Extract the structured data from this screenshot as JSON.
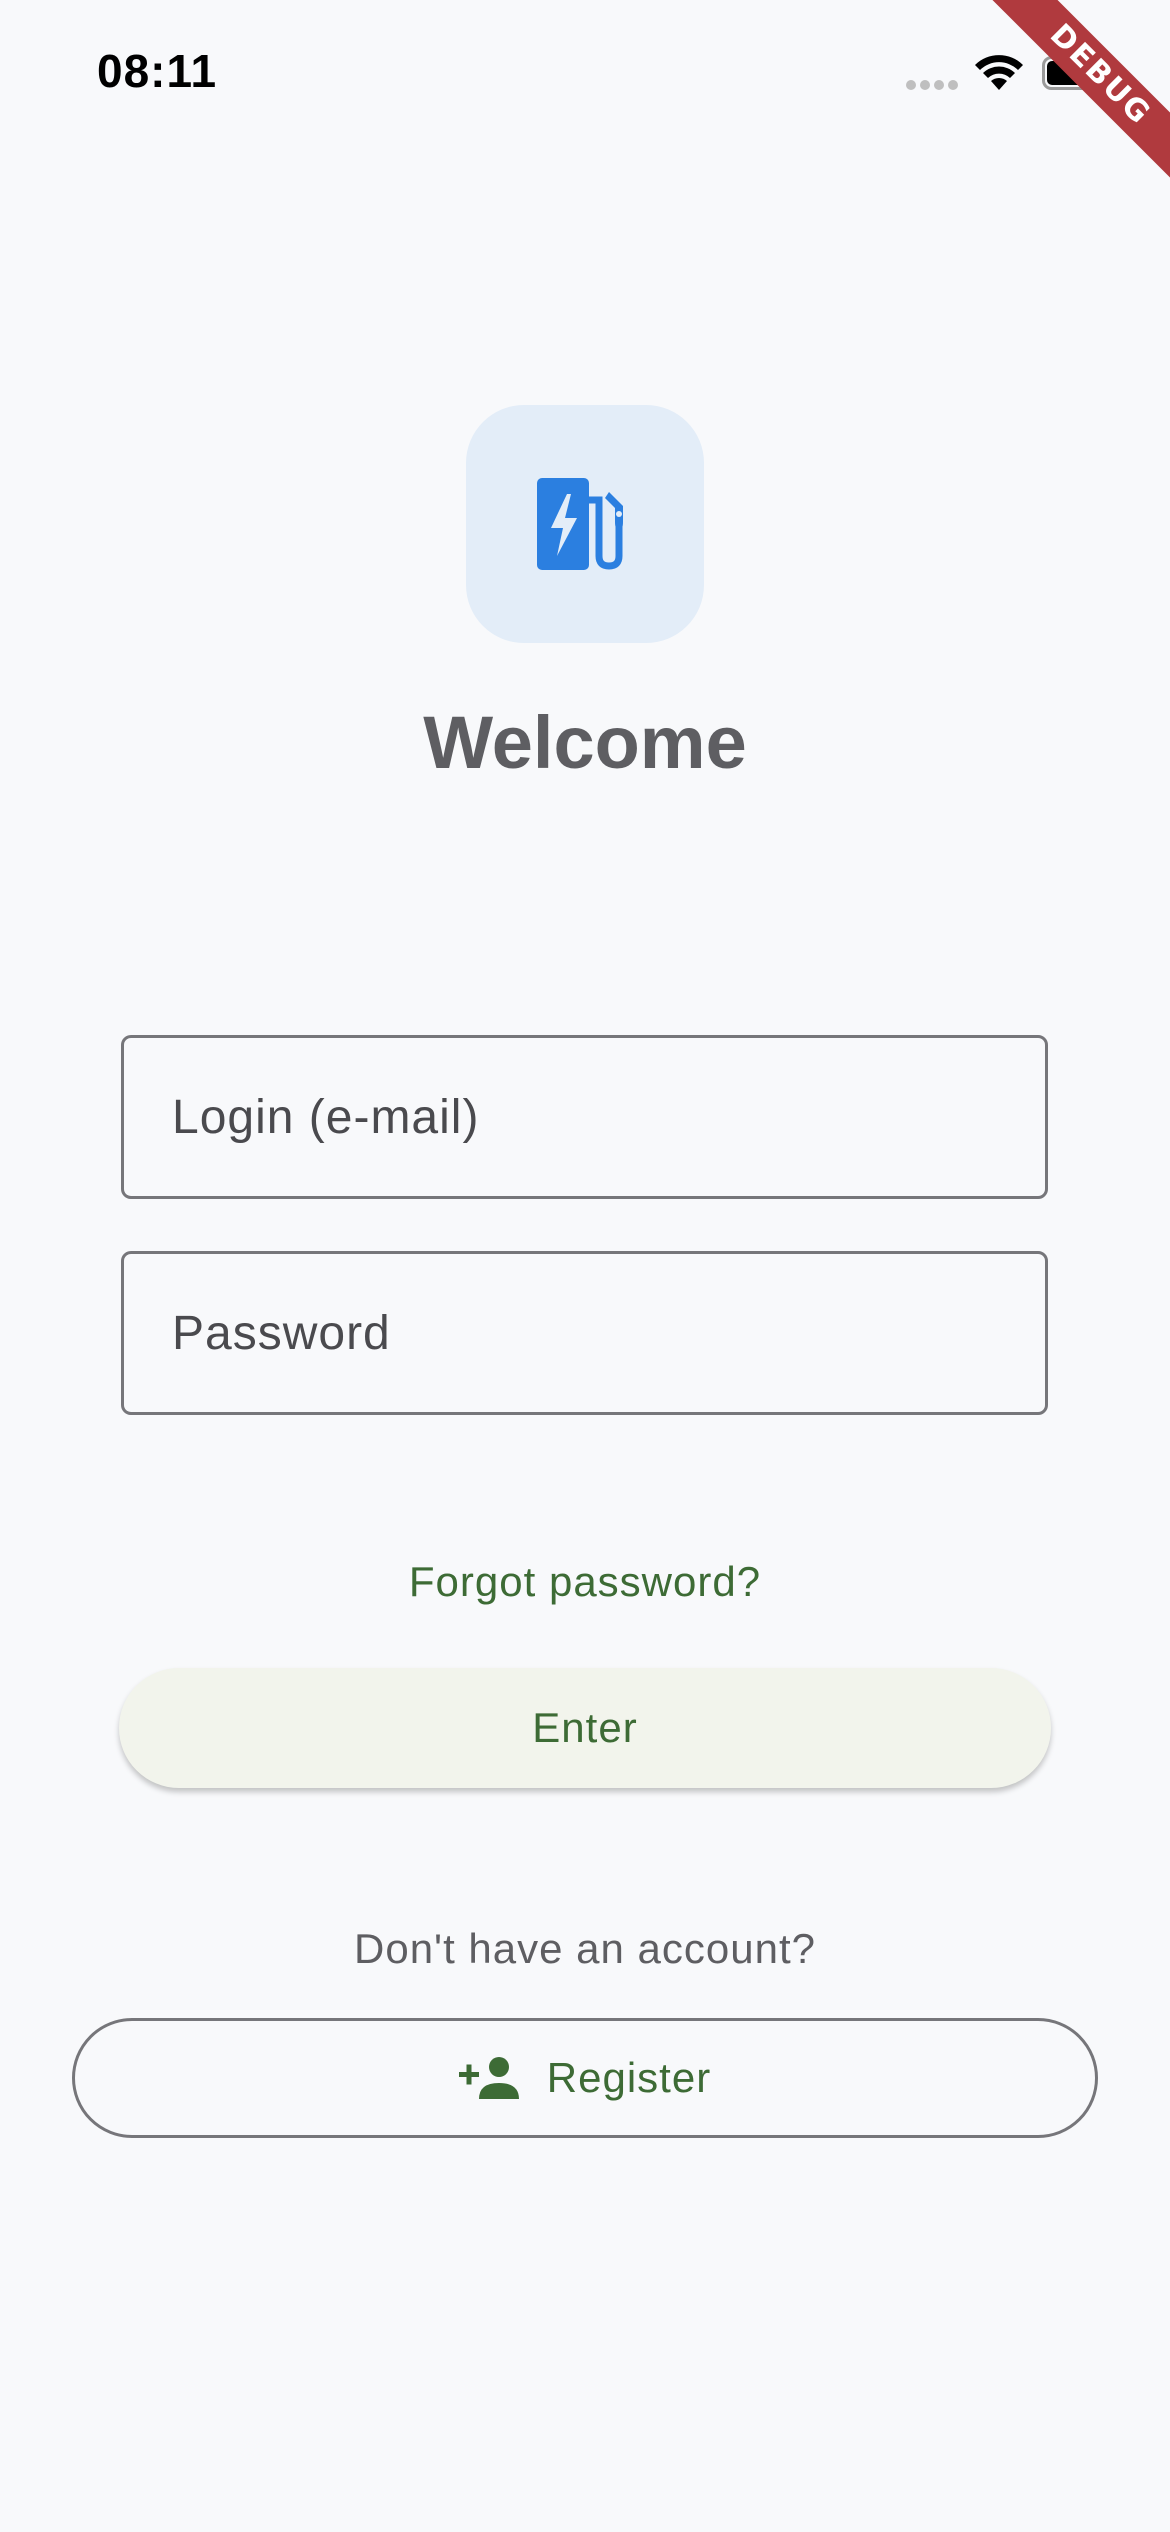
{
  "status_bar": {
    "time": "08:11"
  },
  "debug_banner": {
    "label": "DEBUG"
  },
  "logo": {
    "icon": "ev-charging-station-icon",
    "tile_color": "#e3edf8",
    "icon_color": "#2b7fe0"
  },
  "title": "Welcome",
  "form": {
    "email_placeholder": "Login (e-mail)",
    "email_value": "",
    "password_placeholder": "Password",
    "password_value": ""
  },
  "forgot_password_label": "Forgot password?",
  "enter_label": "Enter",
  "account_prompt": "Don't have an account?",
  "register": {
    "icon": "person-add-icon",
    "label": "Register"
  },
  "colors": {
    "background": "#f8f9fb",
    "accent_green": "#3d6b35",
    "title_gray": "#5e5e62"
  }
}
